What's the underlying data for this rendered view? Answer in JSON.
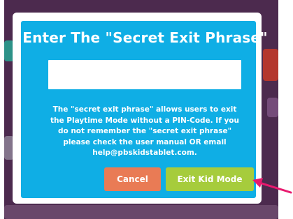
{
  "dialog": {
    "title": "Enter The \"Secret Exit Phrase\"",
    "input": {
      "value": "",
      "placeholder": ""
    },
    "info_line1": "The \"secret exit phrase\" allows users to exit",
    "info_line2": "the Playtime Mode without a PIN-Code. If you",
    "info_line3": "do not remember the \"secret exit phrase\"",
    "info_line4": "please check the user manual OR email",
    "info_line5": "help@pbskidstablet.com.",
    "cancel_label": "Cancel",
    "exit_label": "Exit Kid Mode"
  },
  "colors": {
    "dialog_bg": "#0faee5",
    "cancel_bg": "#e97b55",
    "exit_bg": "#a6cc3c",
    "arrow": "#e8196e",
    "backdrop": "#4c2a4e"
  },
  "icons": {
    "annotation_arrow": "arrow-pointing-left-icon"
  }
}
